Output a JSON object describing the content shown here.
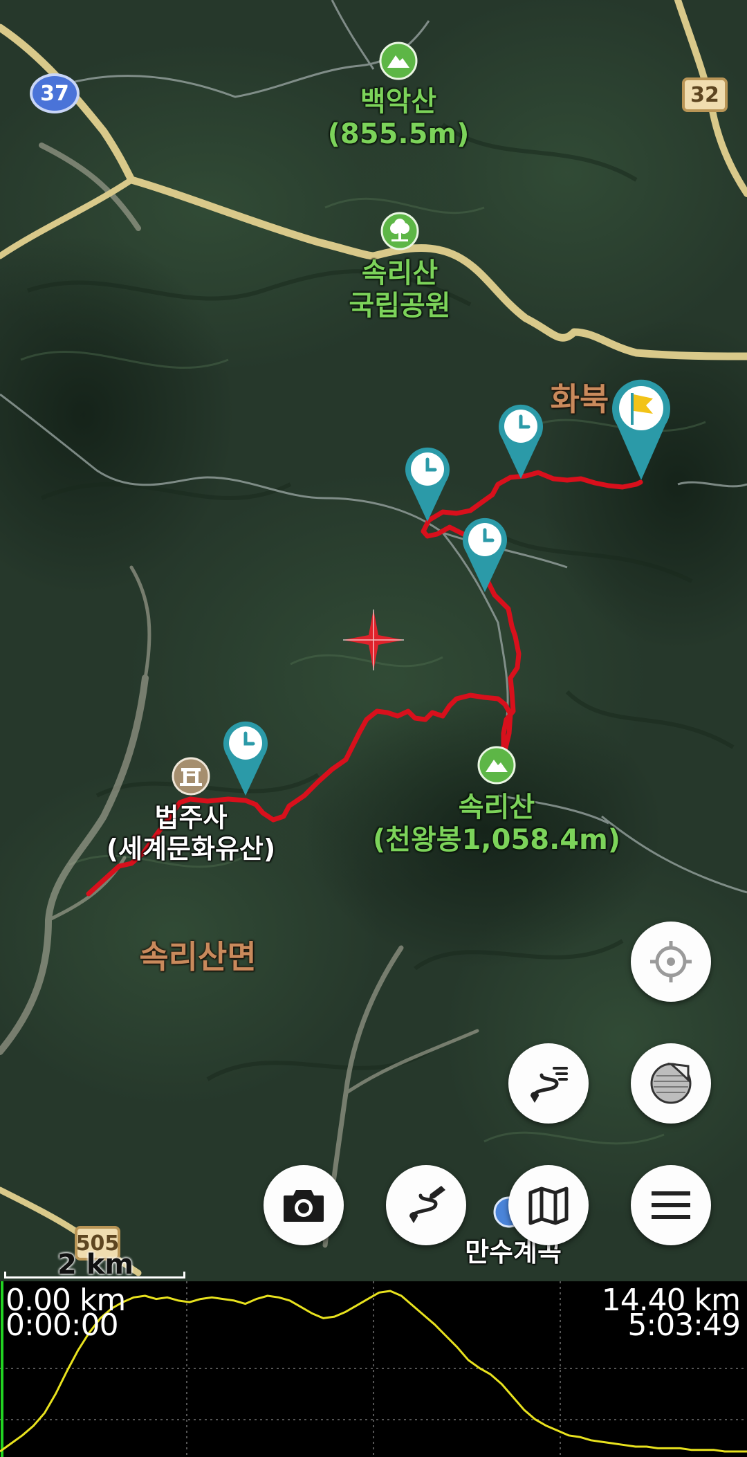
{
  "map": {
    "road_shields": {
      "route_37": "37",
      "route_32": "32",
      "route_505": "505"
    },
    "labels": {
      "baegaksan_name": "백악산",
      "baegaksan_elev": "(855.5m)",
      "park_name_1": "속리산",
      "park_name_2": "국립공원",
      "hwabuk": "화북",
      "beopjusa_name": "법주사",
      "beopjusa_sub": "(세계문화유산)",
      "songnisan_name": "속리산",
      "songnisan_sub": "(천왕봉1,058.4m)",
      "songnisan_myeon": "속리산면",
      "mansu": "만수계곡"
    },
    "scale_label": "2 km",
    "colors": {
      "track": "#d8101c",
      "pin": "#2b9aa8",
      "peak_icon": "#5db646",
      "temple_icon": "#a58e6e",
      "road": "#d9c98a"
    },
    "icons": {
      "waypoint": "clock-icon",
      "end": "flag-icon",
      "center": "crosshair-icon"
    }
  },
  "buttons": {
    "locate": "locate-target-icon",
    "track_list": "route-list-icon",
    "layers": "map-layer-peel-icon",
    "camera": "camera-icon",
    "draw_route": "route-edit-icon",
    "map_type": "map-fold-icon",
    "menu": "hamburger-menu-icon"
  },
  "profile": {
    "start_distance": "0.00 km",
    "start_time": "0:00:00",
    "end_distance": "14.40 km",
    "end_time": "5:03:49",
    "line_color": "#e8e21e",
    "elevation_relative": [
      0.0,
      0.05,
      0.1,
      0.16,
      0.24,
      0.36,
      0.5,
      0.63,
      0.74,
      0.83,
      0.89,
      0.93,
      0.96,
      0.97,
      0.95,
      0.96,
      0.94,
      0.93,
      0.95,
      0.96,
      0.95,
      0.94,
      0.92,
      0.95,
      0.97,
      0.96,
      0.94,
      0.9,
      0.86,
      0.83,
      0.84,
      0.87,
      0.91,
      0.95,
      0.99,
      1.0,
      0.97,
      0.91,
      0.85,
      0.79,
      0.72,
      0.65,
      0.57,
      0.52,
      0.48,
      0.42,
      0.34,
      0.26,
      0.2,
      0.16,
      0.13,
      0.1,
      0.09,
      0.07,
      0.06,
      0.05,
      0.04,
      0.03,
      0.03,
      0.02,
      0.02,
      0.02,
      0.01,
      0.01,
      0.01,
      0.0,
      0.0,
      0.0
    ]
  }
}
